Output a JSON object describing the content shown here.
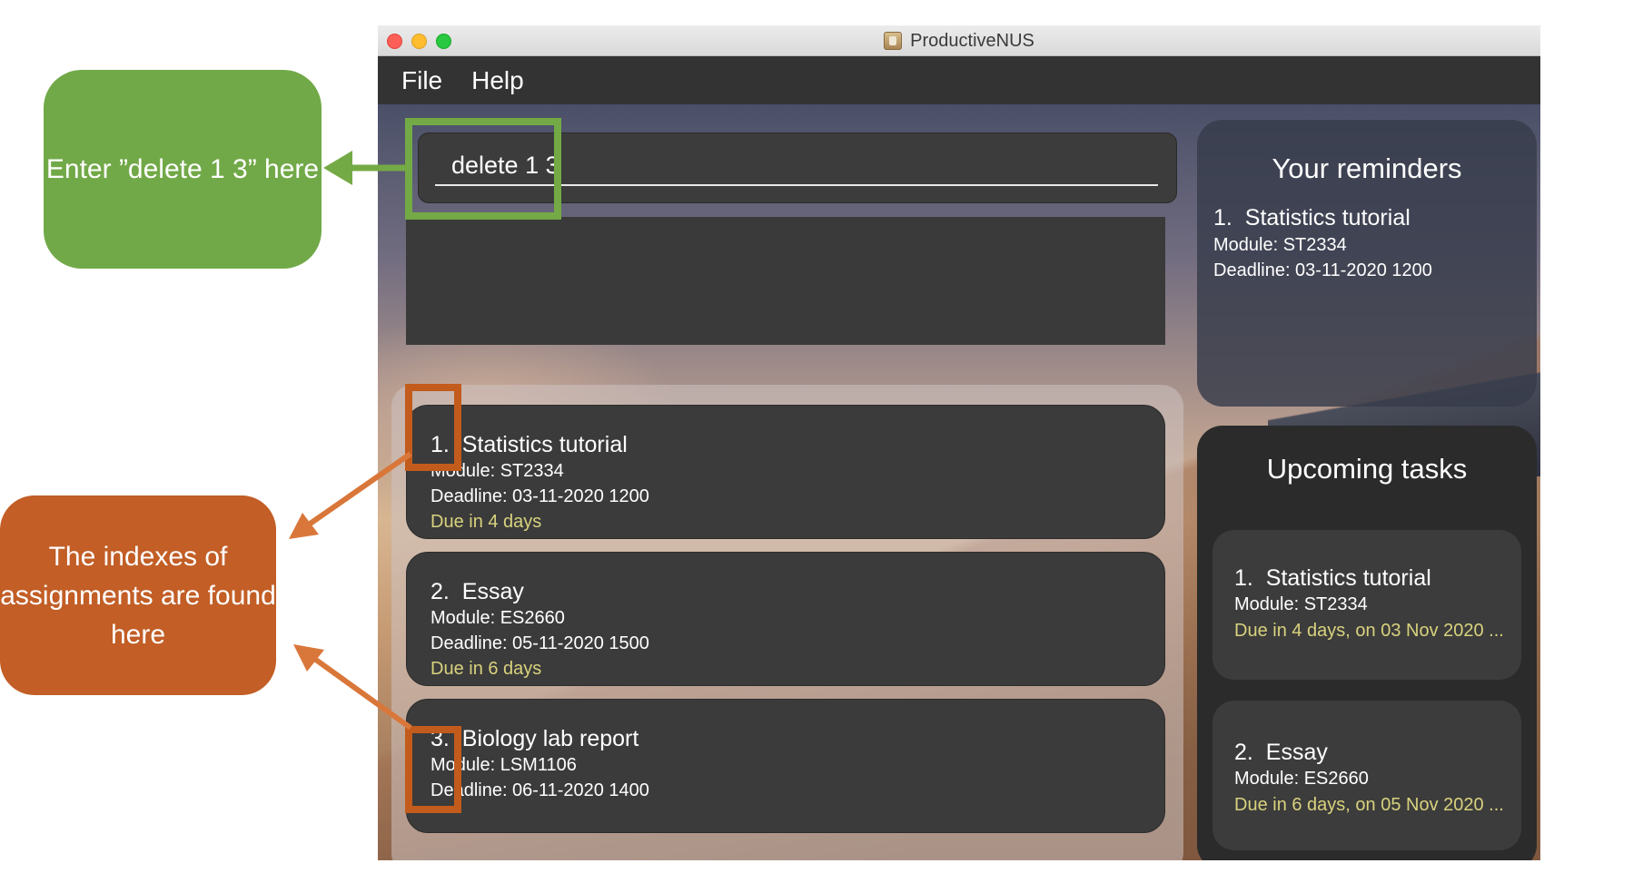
{
  "window": {
    "title": "ProductiveNUS"
  },
  "menu": [
    "File",
    "Help"
  ],
  "command": {
    "value": "delete 1 3"
  },
  "assignments": [
    {
      "index": "1.",
      "name": "Statistics tutorial",
      "module": "Module: ST2334",
      "deadline": "Deadline: 03-11-2020 1200",
      "due": "Due in 4 days"
    },
    {
      "index": "2.",
      "name": "Essay",
      "module": "Module: ES2660",
      "deadline": "Deadline: 05-11-2020 1500",
      "due": "Due in 6 days"
    },
    {
      "index": "3.",
      "name": "Biology lab report",
      "module": "Module: LSM1106",
      "deadline": "Deadline: 06-11-2020 1400"
    }
  ],
  "reminders": {
    "heading": "Your reminders",
    "items": [
      {
        "index": "1.",
        "name": "Statistics tutorial",
        "module": "Module: ST2334",
        "deadline": "Deadline: 03-11-2020 1200"
      }
    ]
  },
  "upcoming": {
    "heading": "Upcoming tasks",
    "items": [
      {
        "index": "1.",
        "name": "Statistics tutorial",
        "module": "Module: ST2334",
        "due": "Due in 4 days, on 03 Nov 2020 ..."
      },
      {
        "index": "2.",
        "name": "Essay",
        "module": "Module: ES2660",
        "due": "Due in 6 days, on 05 Nov 2020 ..."
      }
    ]
  },
  "annotations": {
    "command_callout": "Enter ”delete 1 3” here",
    "index_callout": "The indexes of assignments are found here"
  },
  "colors": {
    "callout_green": "#72a948",
    "callout_orange": "#c25e26",
    "due_text": "#d8d27d",
    "panel_dark": "#3b3b3b"
  }
}
